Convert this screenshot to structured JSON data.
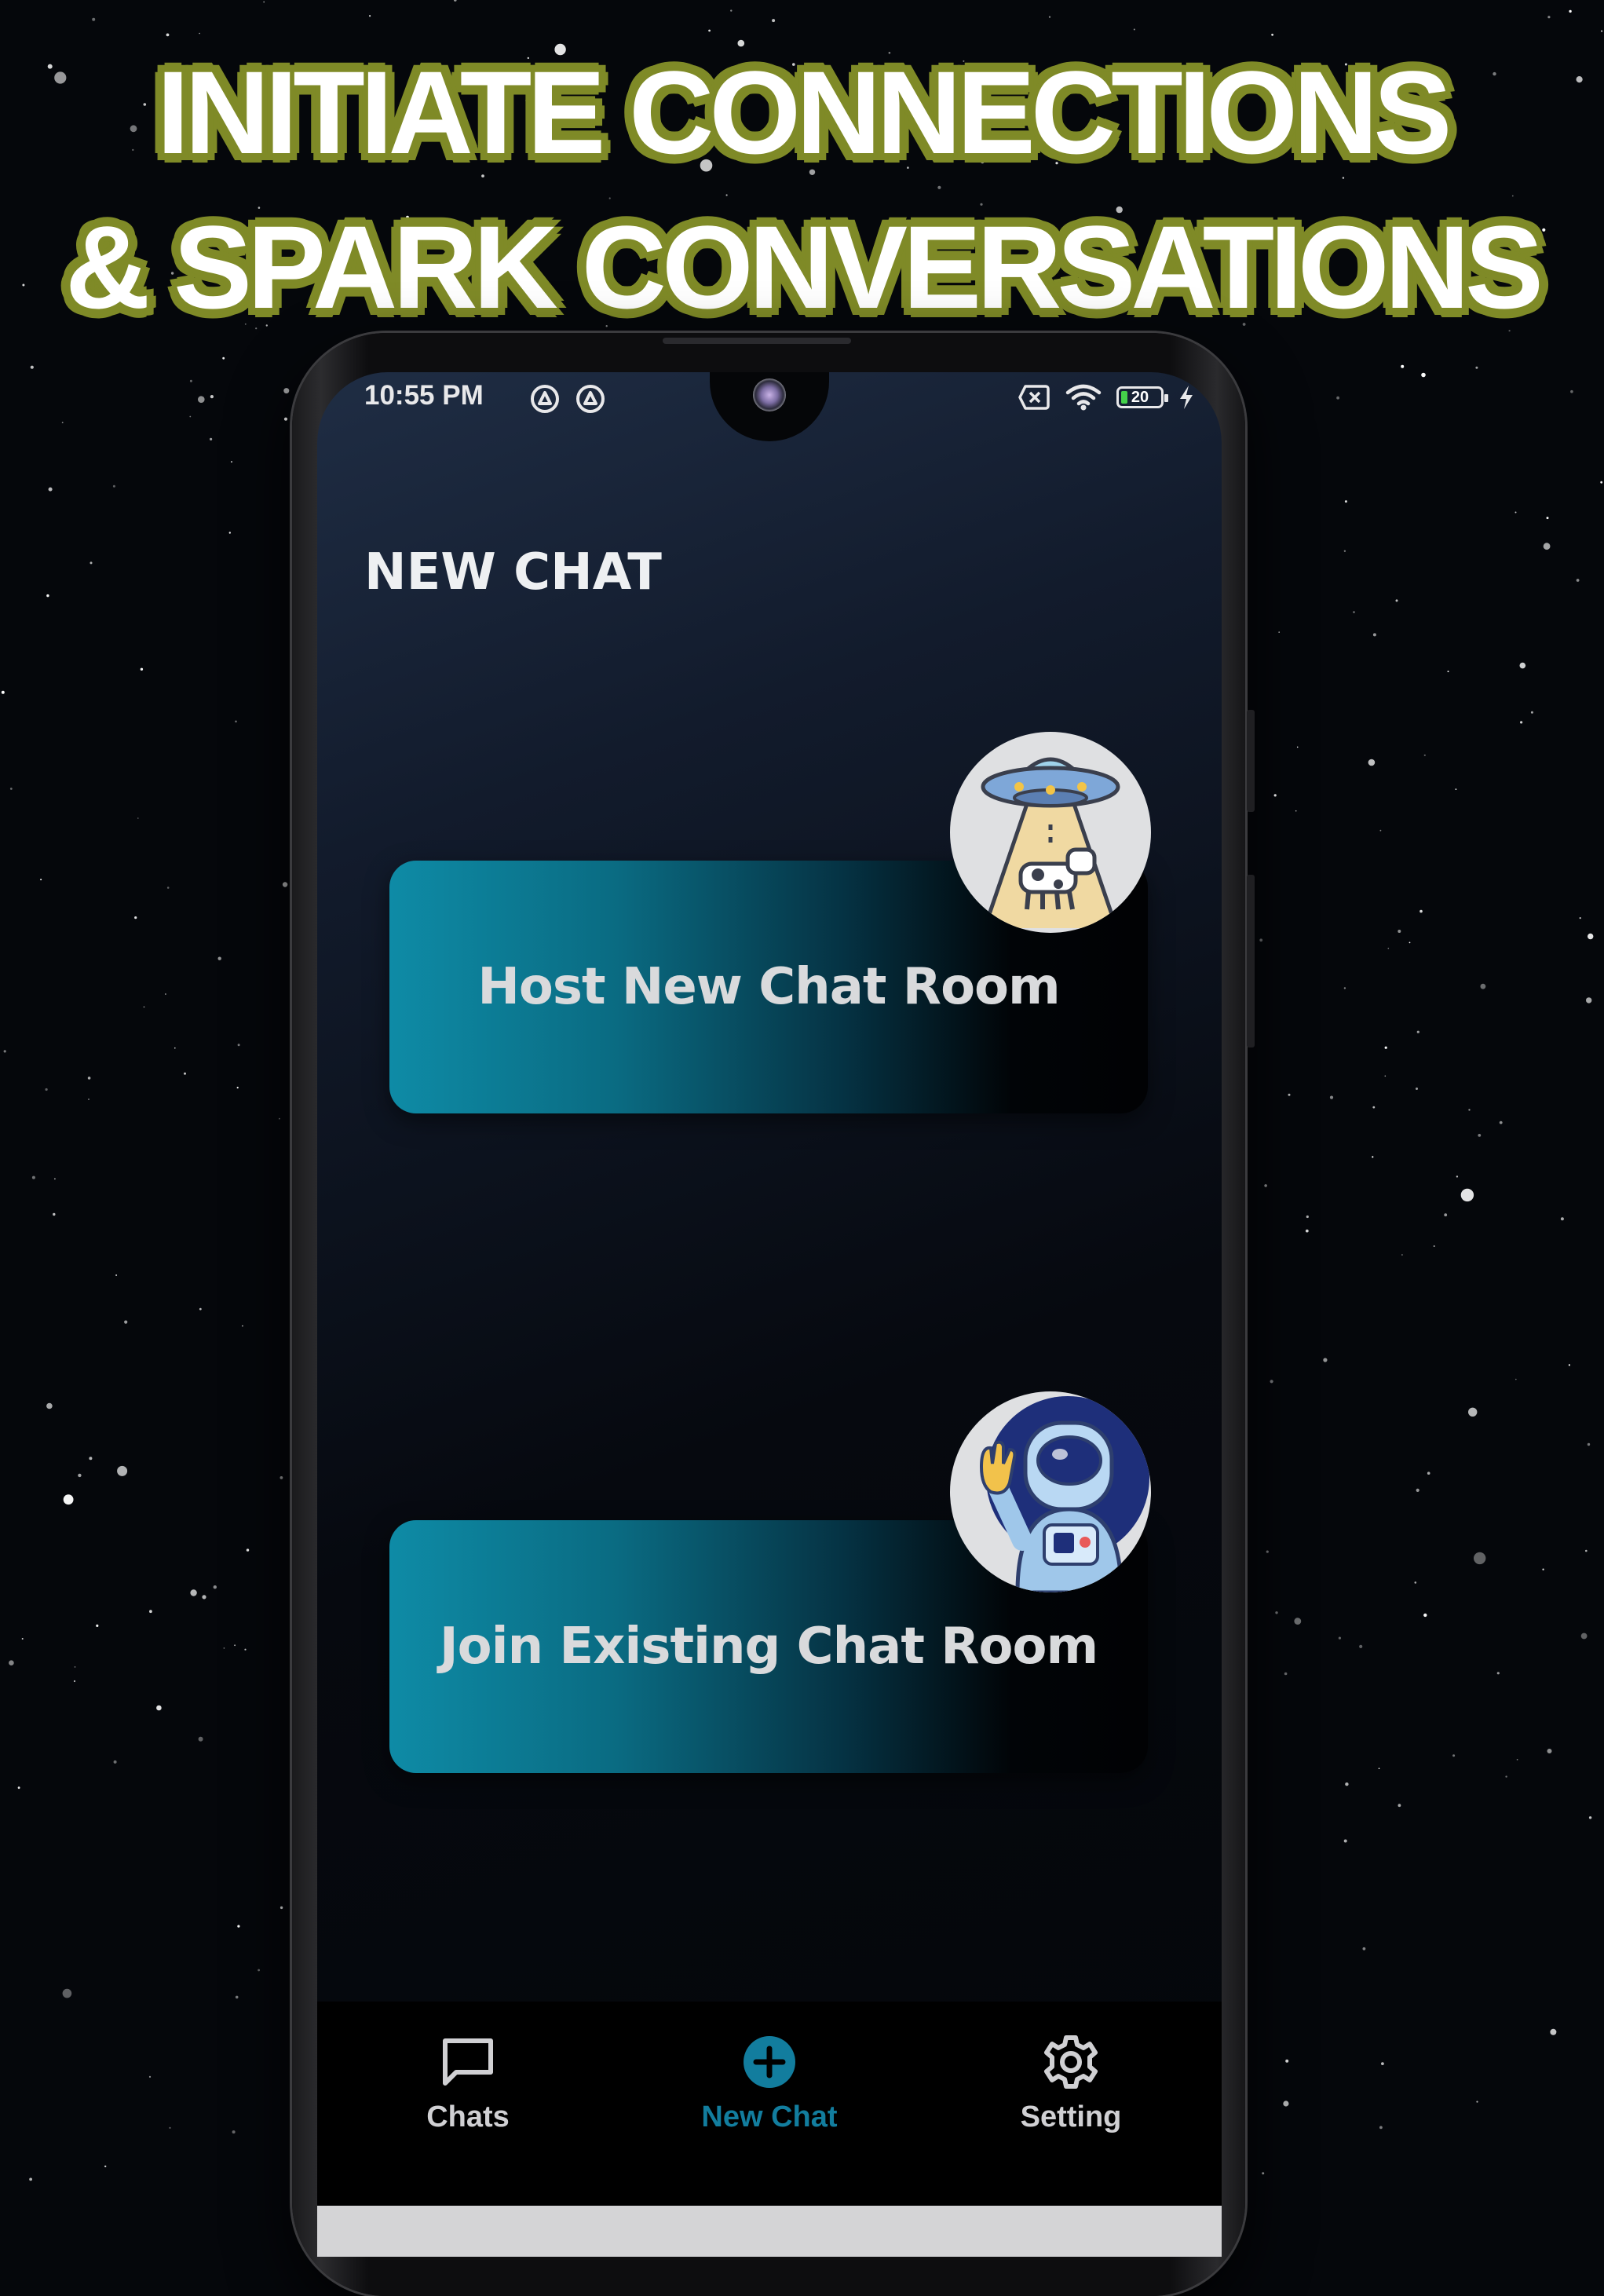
{
  "promo": {
    "line1": "INITIATE CONNECTIONS",
    "line2": "& SPARK CONVERSATIONS",
    "outline_color": "#7f8a27"
  },
  "status_bar": {
    "time": "10:55 PM",
    "battery_level": "20"
  },
  "screen": {
    "title": "NEW CHAT"
  },
  "actions": {
    "host_label": "Host New Chat Room",
    "host_icon": "ufo-cow-icon",
    "join_label": "Join Existing Chat Room",
    "join_icon": "astronaut-waving-icon",
    "card_gradient": [
      "#0e8ba6",
      "#010204"
    ]
  },
  "bottom_nav": {
    "items": [
      {
        "label": "Chats",
        "icon": "chat-bubble-icon",
        "active": false
      },
      {
        "label": "New Chat",
        "icon": "plus-circle-icon",
        "active": true
      },
      {
        "label": "Setting",
        "icon": "gear-icon",
        "active": false
      }
    ],
    "active_color": "#127d9e"
  }
}
